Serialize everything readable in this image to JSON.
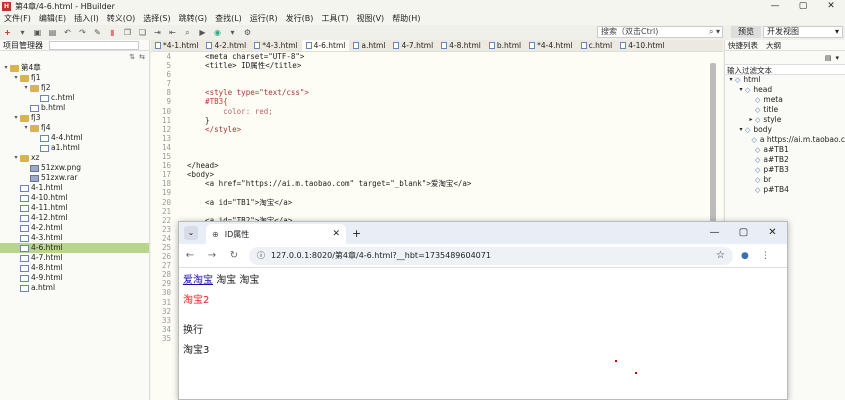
{
  "window": {
    "title": "第4章/4-6.html - HBuilder",
    "app_icon_letter": "H",
    "controls": [
      "—",
      "▢",
      "✕"
    ]
  },
  "menu": [
    "文件(F)",
    "编辑(E)",
    "插入(I)",
    "转义(O)",
    "选择(S)",
    "跳转(G)",
    "查找(L)",
    "运行(R)",
    "发行(B)",
    "工具(T)",
    "视图(V)",
    "帮助(H)"
  ],
  "toolbar": {
    "search_placeholder": "搜索（双击Ctrl)",
    "preview_label": "预览",
    "dev_view_label": "开发视图"
  },
  "project_manager": {
    "title": "项目管理器",
    "tree": [
      {
        "label": "第4章",
        "depth": 0,
        "type": "folder",
        "arrow": "▾"
      },
      {
        "label": "fj1",
        "depth": 1,
        "type": "folder",
        "arrow": "▾"
      },
      {
        "label": "fj2",
        "depth": 2,
        "type": "folder",
        "arrow": "▾"
      },
      {
        "label": "c.html",
        "depth": 3,
        "type": "file",
        "arrow": ""
      },
      {
        "label": "b.html",
        "depth": 2,
        "type": "file",
        "arrow": ""
      },
      {
        "label": "fj3",
        "depth": 1,
        "type": "folder",
        "arrow": "▾"
      },
      {
        "label": "fj4",
        "depth": 2,
        "type": "folder",
        "arrow": "▾"
      },
      {
        "label": "4-4.html",
        "depth": 3,
        "type": "file",
        "arrow": ""
      },
      {
        "label": "a1.html",
        "depth": 3,
        "type": "file",
        "arrow": ""
      },
      {
        "label": "xz",
        "depth": 1,
        "type": "folder",
        "arrow": "▾"
      },
      {
        "label": "51zxw.png",
        "depth": 2,
        "type": "img",
        "arrow": ""
      },
      {
        "label": "51zxw.rar",
        "depth": 2,
        "type": "img",
        "arrow": ""
      },
      {
        "label": "4-1.html",
        "depth": 1,
        "type": "file",
        "arrow": ""
      },
      {
        "label": "4-10.html",
        "depth": 1,
        "type": "file",
        "arrow": ""
      },
      {
        "label": "4-11.html",
        "depth": 1,
        "type": "file",
        "arrow": ""
      },
      {
        "label": "4-12.html",
        "depth": 1,
        "type": "file",
        "arrow": ""
      },
      {
        "label": "4-2.html",
        "depth": 1,
        "type": "file",
        "arrow": ""
      },
      {
        "label": "4-3.html",
        "depth": 1,
        "type": "file",
        "arrow": ""
      },
      {
        "label": "4-6.html",
        "depth": 1,
        "type": "file",
        "arrow": "",
        "selected": true
      },
      {
        "label": "4-7.html",
        "depth": 1,
        "type": "file",
        "arrow": ""
      },
      {
        "label": "4-8.html",
        "depth": 1,
        "type": "file",
        "arrow": ""
      },
      {
        "label": "4-9.html",
        "depth": 1,
        "type": "file",
        "arrow": ""
      },
      {
        "label": "a.html",
        "depth": 1,
        "type": "file",
        "arrow": ""
      }
    ]
  },
  "editor_tabs": [
    "*4-1.html",
    "4-2.html",
    "*4-3.html",
    "4-6.html",
    "a.html",
    "4-7.html",
    "4-8.html",
    "b.html",
    "*4-4.html",
    "c.html",
    "4-10.html"
  ],
  "active_tab_index": 3,
  "code": {
    "line_numbers": [
      "4",
      "5",
      "6",
      "7",
      "8",
      "9",
      "10",
      "11",
      "12",
      "13",
      "14",
      "15",
      "16",
      "17",
      "18",
      "19",
      "20",
      "21",
      "22",
      "23",
      "24",
      "25",
      "26",
      "27",
      "28",
      "29",
      "30",
      "31",
      "32",
      "33",
      "34",
      "35"
    ],
    "lines": [
      "    <meta charset=\"UTF-8\">",
      "    <title> ID属性</title>",
      "",
      "",
      "    <style type=\"text/css\">",
      "    #TB3{",
      "        color: red;",
      "    }",
      "    </style>",
      "",
      "",
      "",
      "</head>",
      "<body>",
      "    <a href=\"https://ai.m.taobao.com\" target=\"_blank\">爱淘宝</a>",
      "",
      "    <a id=\"TB1\">淘宝</a>",
      "",
      "    <a id=\"TB2\">淘宝</a>",
      "",
      "",
      "",
      "",
      "",
      "",
      "",
      "",
      "</",
      "",
      "",
      "",
      ""
    ]
  },
  "outline": {
    "tabs": [
      "快捷列表",
      "大纲"
    ],
    "filter_label": "输入过滤文本",
    "items": [
      {
        "label": "html",
        "depth": 0,
        "arrow": "▾"
      },
      {
        "label": "head",
        "depth": 1,
        "arrow": "▾"
      },
      {
        "label": "meta",
        "depth": 2,
        "arrow": ""
      },
      {
        "label": "title",
        "depth": 2,
        "arrow": ""
      },
      {
        "label": "style",
        "depth": 2,
        "arrow": "▸"
      },
      {
        "label": "body",
        "depth": 1,
        "arrow": "▾"
      },
      {
        "label": "a https://ai.m.taobao.c",
        "depth": 2,
        "arrow": ""
      },
      {
        "label": "a#TB1",
        "depth": 2,
        "arrow": ""
      },
      {
        "label": "a#TB2",
        "depth": 2,
        "arrow": ""
      },
      {
        "label": "p#TB3",
        "depth": 2,
        "arrow": ""
      },
      {
        "label": "br",
        "depth": 2,
        "arrow": ""
      },
      {
        "label": "p#TB4",
        "depth": 2,
        "arrow": ""
      }
    ]
  },
  "browser": {
    "tab_title": "ID属性",
    "url": "127.0.0.1:8020/第4章/4-6.html?__hbt=1735489604071",
    "content": {
      "link_text": "爱淘宝",
      "inline_text1": "淘宝",
      "inline_text2": "淘宝",
      "red_text": "淘宝2",
      "line3": "换行",
      "line4": "淘宝3"
    }
  }
}
